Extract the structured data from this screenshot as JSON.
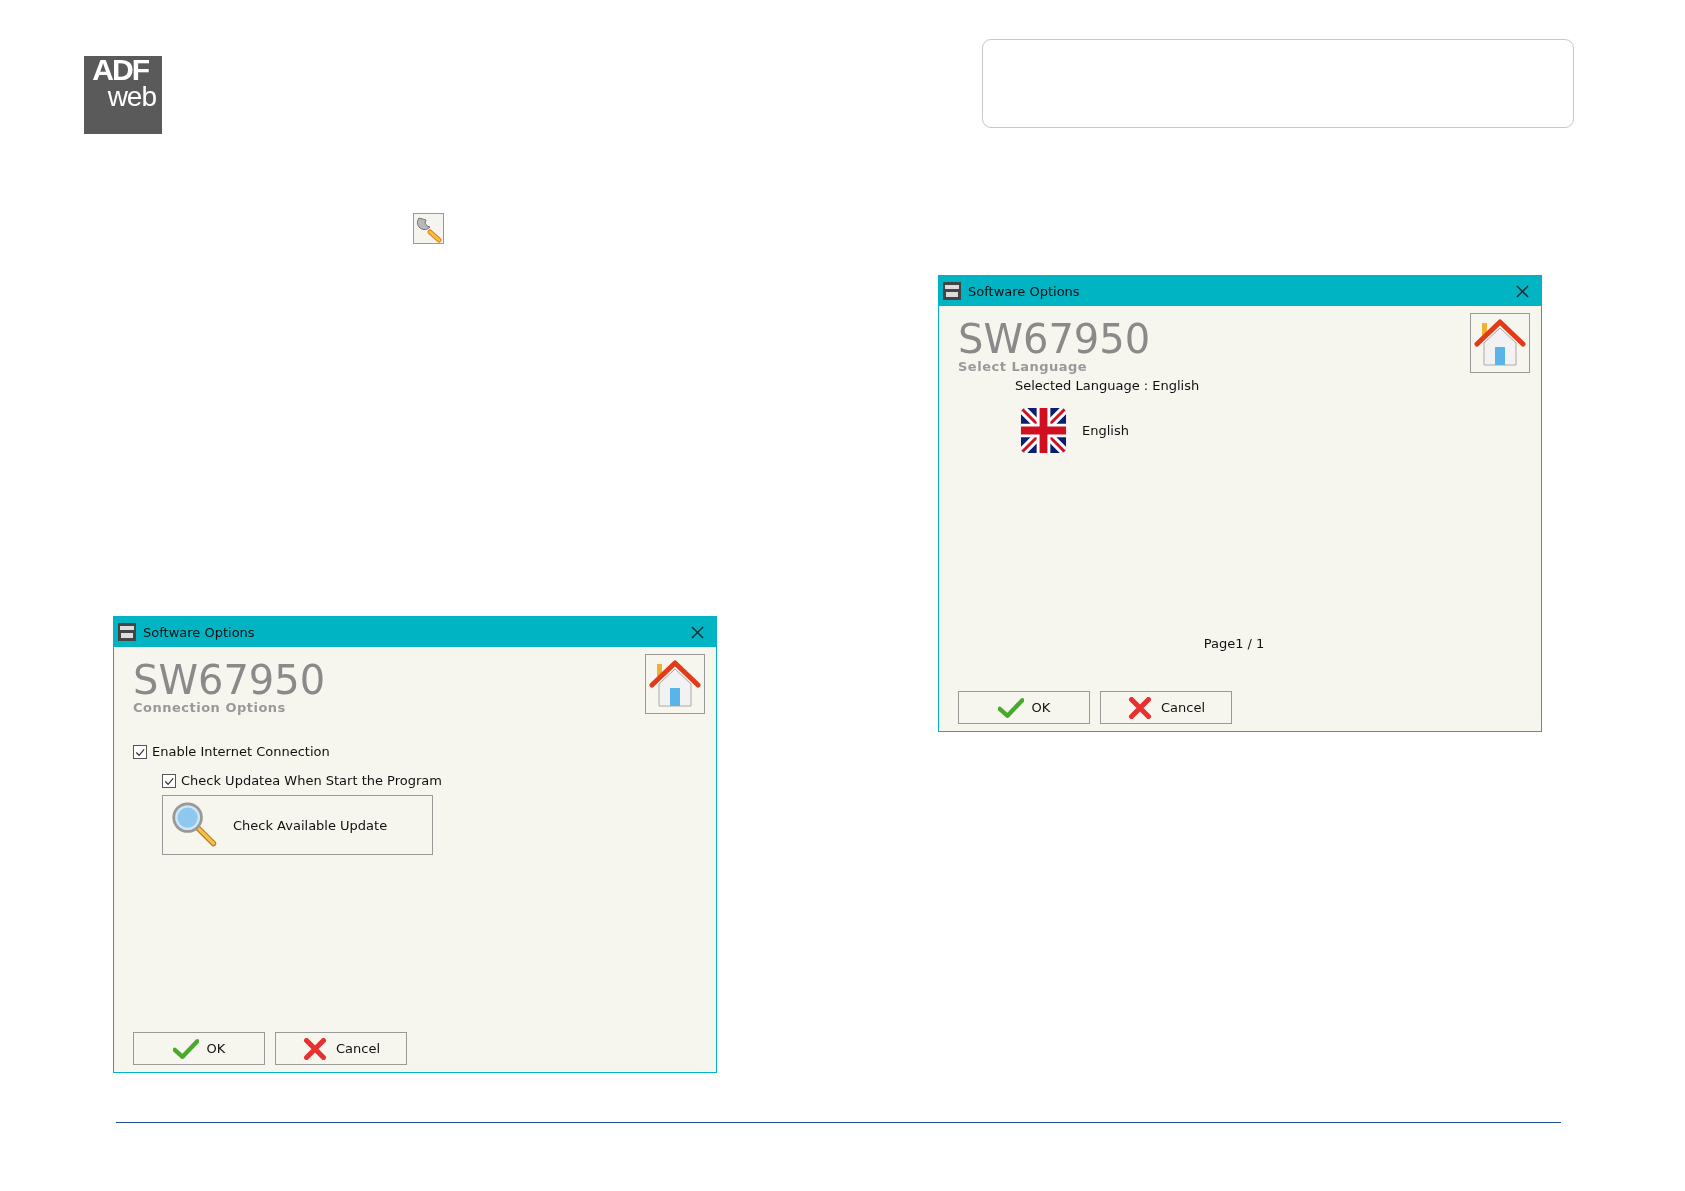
{
  "logo": {
    "top": "ADF",
    "bottom": "web"
  },
  "dialogs": [
    {
      "kind": "connection",
      "title": "Software Options",
      "product": "SW67950",
      "subtitle": "Connection Options",
      "options": [
        {
          "label": "Enable Internet Connection",
          "checked": true,
          "children": [
            {
              "label": "Check Updatea When Start the Program",
              "checked": true
            }
          ]
        }
      ],
      "update_button": "Check Available Update",
      "buttons": [
        {
          "label": "OK",
          "kind": "ok"
        },
        {
          "label": "Cancel",
          "kind": "cancel"
        }
      ]
    },
    {
      "kind": "language",
      "title": "Software Options",
      "product": "SW67950",
      "subtitle": "Select Language",
      "selected_language": "Selected Language : English",
      "languages": [
        {
          "label": "English"
        }
      ],
      "page": "Page1 / 1",
      "buttons": [
        {
          "label": "OK",
          "kind": "ok"
        },
        {
          "label": "Cancel",
          "kind": "cancel"
        }
      ]
    }
  ]
}
